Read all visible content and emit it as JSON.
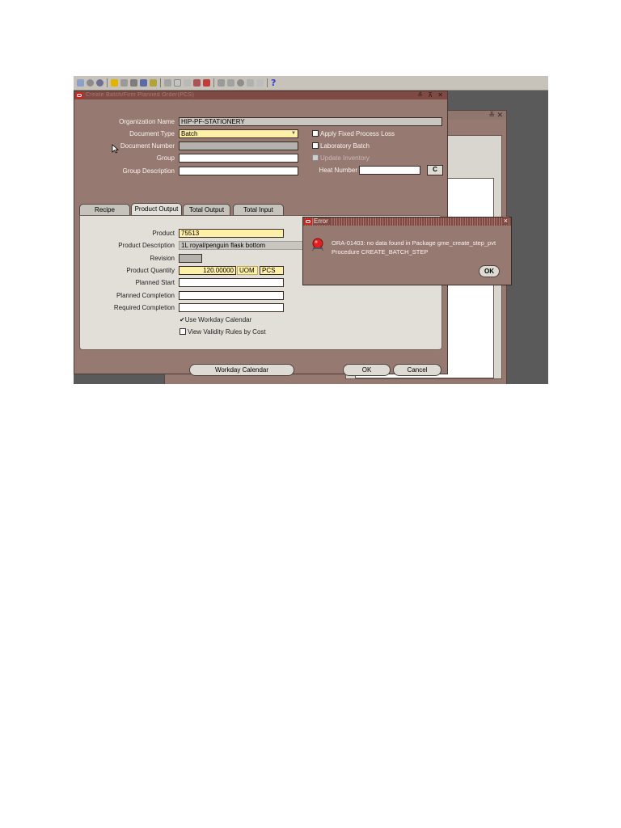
{
  "toolbar": {
    "icons": [
      "new-icon",
      "find-icon",
      "navigator-icon",
      "open-folder-icon",
      "save-icon",
      "print-icon",
      "close-form-icon",
      "cut-icon",
      "copy-icon",
      "paste-icon",
      "clear-icon",
      "delete-icon",
      "edit-icon",
      "zoom-icon",
      "translations-icon",
      "attachments-icon",
      "folder-tools-icon",
      "help-icon"
    ],
    "help_label": "?"
  },
  "main_window": {
    "title": "Create Batch/Firm Planned Order(PCS)",
    "window_controls": "≚ ⊼ ✕",
    "header": {
      "org_label": "Organization Name",
      "org_value": "HIP-PF-STATIONERY",
      "doctype_label": "Document Type",
      "doctype_value": "Batch",
      "docnum_label": "Document Number",
      "docnum_value": "",
      "group_label": "Group",
      "group_value": "",
      "groupdesc_label": "Group Description",
      "groupdesc_value": "",
      "apply_fixed_label": "Apply Fixed Process Loss",
      "lab_batch_label": "Laboratory Batch",
      "update_inv_label": "Update Inventory",
      "heat_label": "Heat Number",
      "heat_value": "",
      "heat_btn": "C"
    },
    "tabs": [
      "Recipe",
      "Product Output",
      "Total Output",
      "Total Input"
    ],
    "active_tab": "Product Output",
    "product": {
      "product_label": "Product",
      "product_value": "75513",
      "desc_label": "Product Description",
      "desc_value": "1L royal/penguin flask bottom",
      "revision_label": "Revision",
      "revision_value": "",
      "qty_label": "Product Quantity",
      "qty_value": "120.00000",
      "uom_label": "UOM",
      "uom_value": "PCS",
      "planned_start_label": "Planned Start",
      "planned_completion_label": "Planned Completion",
      "required_completion_label": "Required Completion",
      "use_workday_label": "Use Workday Calendar",
      "view_validity_label": "View Validity Rules by Cost"
    },
    "buttons": {
      "workday": "Workday Calendar",
      "ok": "OK",
      "cancel": "Cancel"
    }
  },
  "error_dialog": {
    "title": "Error",
    "close": "×",
    "line1": "ORA-01403: no data found in Package gme_create_step_pvt",
    "line2": "Procedure CREATE_BATCH_STEP",
    "ok": "OK"
  },
  "background_window": {
    "controls": "≚ ✕"
  },
  "colors": {
    "window_bg": "#967a72",
    "title_bar": "#7f4a43",
    "required_field": "#fff0a8",
    "toolbar_bg": "#c7c3bb",
    "oracle_red": "#d2201b"
  }
}
